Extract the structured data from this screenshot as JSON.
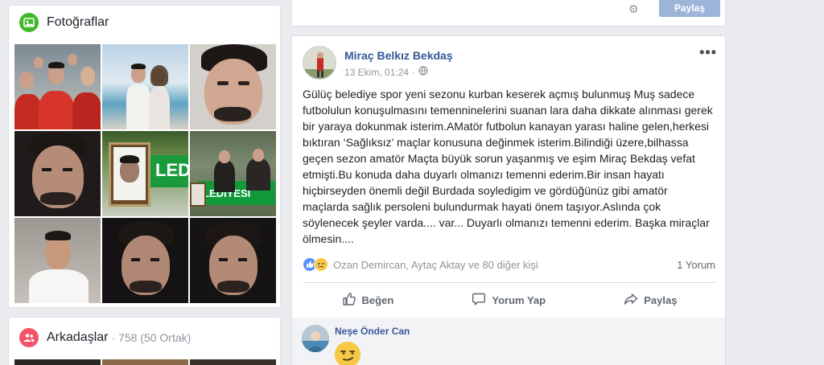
{
  "photos": {
    "title": "Fotoğraflar",
    "icon": "photo-icon"
  },
  "friends": {
    "title": "Arkadaşlar",
    "count": "· 758 (50 Ortak)",
    "icon": "friends-icon"
  },
  "share_bar": {
    "gear_icon": "gear-icon",
    "share_label": "Paylaş"
  },
  "post": {
    "author": "Miraç Belkız Bekdaş",
    "timestamp": "13 Ekim, 01:24 ·",
    "privacy_icon": "globe-icon",
    "more_icon": "•••",
    "text": "Gülüç belediye spor yeni sezonu kurban keserek açmış bulunmuş Muş sadece futbolulun konuşulmasını temenninelerini suanan lara daha dikkate alınması gerek bir yaraya dokunmak isterim.AMatör futbolun kanayan yarası haline gelen,herkesi bıktıran ‘Sağlıksız’ maçlar konusuna değinmek isterim.Bilindiği üzere,bilhassa geçen sezon amatör Maçta büyük sorun yaşanmış ve eşim Miraç Bekdaş vefat etmişti.Bu konuda daha duyarlı olmanızı temenni ederim.Bir insan hayatı hiçbirseyden önemli değil Burdada soyledigim ve gördüğünüz gibi amatör maçlarda sağlık persoleni bulundurmak hayati önem taşıyor.Aslında çok söylenecek şeyler varda.... var... Duyarlı olmanızı temenni ederim. Başka miraçlar ölmesin....",
    "reactions_text": "Ozan Demircan, Aytaç Aktay ve 80 diğer kişi",
    "comment_count": "1 Yorum",
    "actions": {
      "like": "Beğen",
      "comment": "Yorum Yap",
      "share": "Paylaş"
    }
  },
  "comment": {
    "author": "Neşe Önder Can",
    "content_icon": "smirk-emoji-icon"
  },
  "colors": {
    "link": "#365899",
    "page_bg": "#e9ebee",
    "share_btn": "#9cb4d8",
    "green": "#42b72a",
    "pink": "#f35369"
  }
}
